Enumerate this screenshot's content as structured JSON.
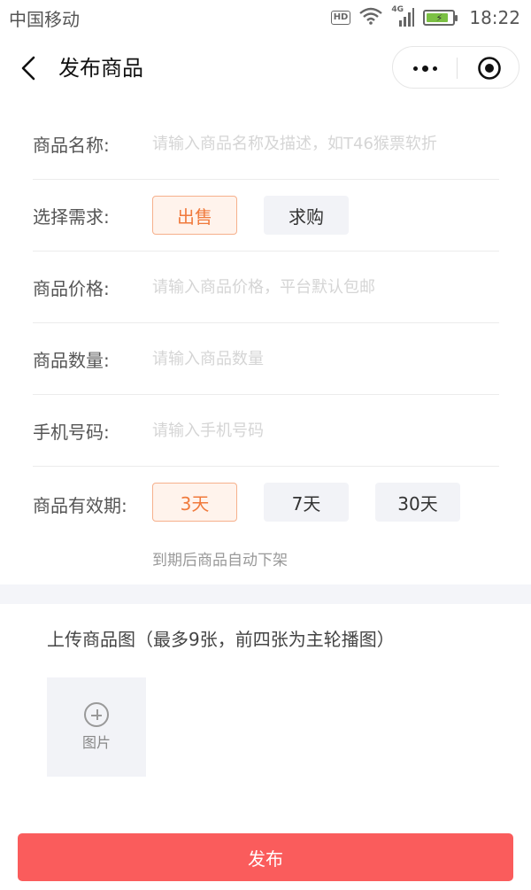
{
  "status_bar": {
    "carrier": "中国移动",
    "hd": "HD",
    "network": "4G",
    "time": "18:22",
    "battery_level": 0.85,
    "icons": [
      "hd-icon",
      "wifi-icon",
      "signal-icon",
      "battery-icon"
    ]
  },
  "nav": {
    "title": "发布商品",
    "back_icon": "back-chevron-icon",
    "more_icon": "more-dots-icon",
    "close_icon": "target-close-icon"
  },
  "form": {
    "name": {
      "label": "商品名称:",
      "value": "",
      "placeholder": "请输入商品名称及描述，如T46猴票软折"
    },
    "demand": {
      "label": "选择需求:",
      "options": [
        "出售",
        "求购"
      ],
      "selected": "出售"
    },
    "price": {
      "label": "商品价格:",
      "value": "",
      "placeholder": "请输入商品价格，平台默认包邮"
    },
    "quantity": {
      "label": "商品数量:",
      "value": "",
      "placeholder": "请输入商品数量"
    },
    "phone": {
      "label": "手机号码:",
      "value": "",
      "placeholder": "请输入手机号码"
    },
    "validity": {
      "label": "商品有效期:",
      "options": [
        "3天",
        "7天",
        "30天"
      ],
      "selected": "3天",
      "hint": "到期后商品自动下架"
    }
  },
  "upload": {
    "title": "上传商品图（最多9张，前四张为主轮播图）",
    "add_label": "图片",
    "add_icon": "plus-circle-icon"
  },
  "actions": {
    "publish_label": "发布"
  },
  "colors": {
    "accent": "#f07a3c",
    "chip_active_bg": "#fff3ec",
    "chip_bg": "#f2f3f7",
    "publish_bg": "#fa5c5c",
    "divider": "#ececec",
    "section_gap": "#f4f5f9"
  }
}
